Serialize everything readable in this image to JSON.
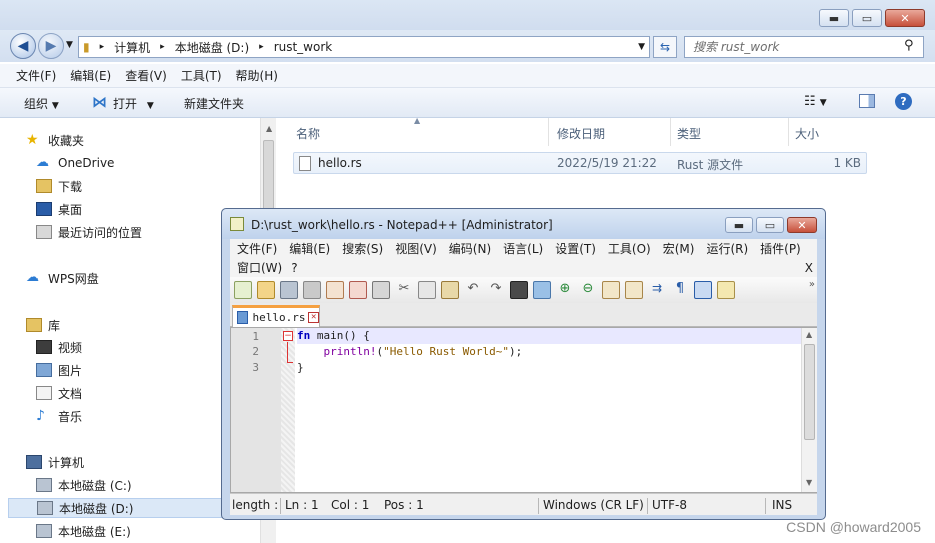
{
  "explorer": {
    "breadcrumb": [
      "计算机",
      "本地磁盘 (D:)",
      "rust_work"
    ],
    "search_placeholder": "搜索 rust_work",
    "menu": [
      "文件(F)",
      "编辑(E)",
      "查看(V)",
      "工具(T)",
      "帮助(H)"
    ],
    "commands": {
      "organize": "组织",
      "open": "打开",
      "new_folder": "新建文件夹"
    },
    "sidebar": {
      "favorites": "收藏夹",
      "onedrive": "OneDrive",
      "downloads": "下载",
      "desktop": "桌面",
      "recent": "最近访问的位置",
      "wps": "WPS网盘",
      "libraries": "库",
      "videos": "视频",
      "pictures": "图片",
      "documents": "文档",
      "music": "音乐",
      "computer": "计算机",
      "drive_c": "本地磁盘 (C:)",
      "drive_d": "本地磁盘 (D:)",
      "drive_e": "本地磁盘 (E:)"
    },
    "columns": {
      "name": "名称",
      "modified": "修改日期",
      "type": "类型",
      "size": "大小"
    },
    "file": {
      "name": "hello.rs",
      "modified": "2022/5/19 21:22",
      "type": "Rust 源文件",
      "size": "1 KB"
    }
  },
  "npp": {
    "title": "D:\\rust_work\\hello.rs - Notepad++ [Administrator]",
    "menu_row1": [
      "文件(F)",
      "编辑(E)",
      "搜索(S)",
      "视图(V)",
      "编码(N)",
      "语言(L)",
      "设置(T)",
      "工具(O)",
      "宏(M)",
      "运行(R)",
      "插件(P)"
    ],
    "menu_row2": [
      "窗口(W)",
      "?"
    ],
    "close_x": "X",
    "tab": "hello.rs",
    "lines": [
      "1",
      "2",
      "3"
    ],
    "code": {
      "kw": "fn",
      "fn_rest": " main() {",
      "macro": "println!",
      "str_open": "(",
      "str": "\"Hello Rust World~\"",
      "str_close": ");",
      "close": "}"
    },
    "status": {
      "length": "length :",
      "ln": "Ln : 1",
      "col": "Col : 1",
      "pos": "Pos : 1",
      "eol": "Windows (CR LF)",
      "enc": "UTF-8",
      "ins": "INS"
    }
  },
  "watermark": "CSDN @howard2005"
}
